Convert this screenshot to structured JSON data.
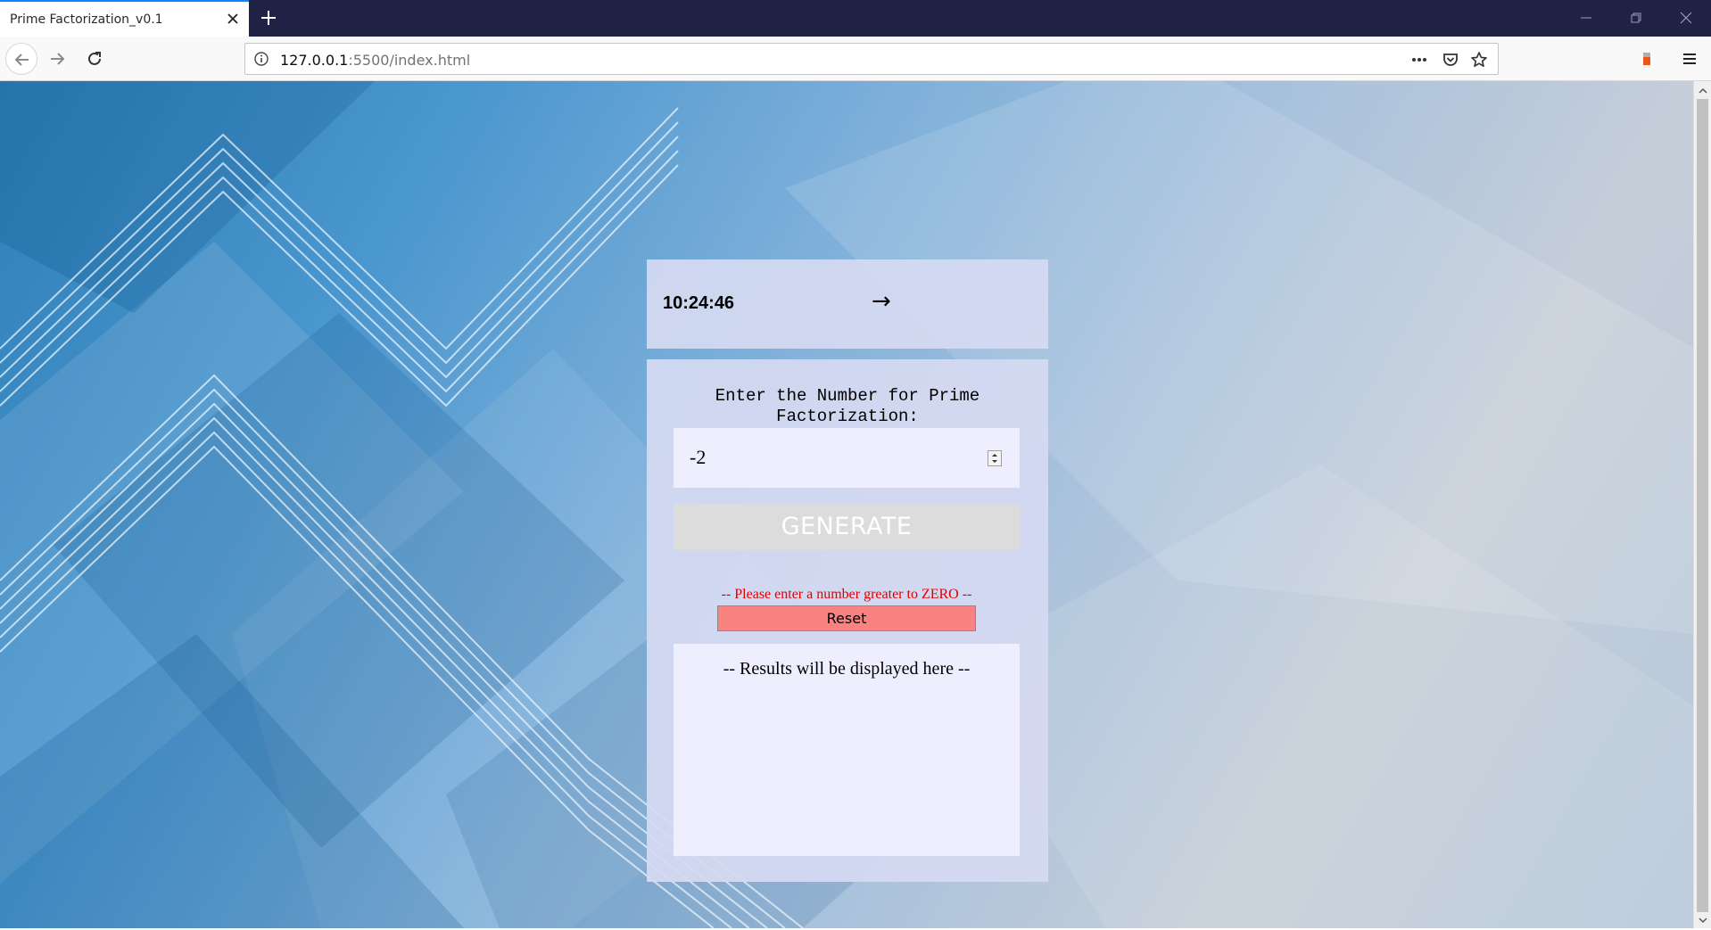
{
  "browser": {
    "tab_title": "Prime Factorization_v0.1",
    "url_host": "127.0.0.1",
    "url_path": ":5500/index.html",
    "icons": [
      "close-icon",
      "plus-icon",
      "minimize-icon",
      "restore-icon",
      "window-close-icon",
      "back-arrow-icon",
      "forward-arrow-icon",
      "reload-icon",
      "info-icon",
      "more-icon",
      "pocket-icon",
      "star-icon",
      "extension-icon",
      "hamburger-menu-icon"
    ]
  },
  "clock": {
    "time": "10:24:46",
    "arrow": "→"
  },
  "form": {
    "prompt": "Enter the Number for Prime Factorization:",
    "input_value": "-2",
    "generate_label": "GENERATE",
    "error_message": "-- Please enter a number greater to ZERO --",
    "reset_label": "Reset"
  },
  "results": {
    "placeholder": "-- Results will be displayed here --"
  },
  "colors": {
    "tabbar": "#1f2244",
    "panel": "#d6daf2",
    "input_bg": "#eeeeff",
    "generate_bg": "#dcdcdc",
    "error": "#e00000",
    "reset_bg": "#f88380"
  }
}
